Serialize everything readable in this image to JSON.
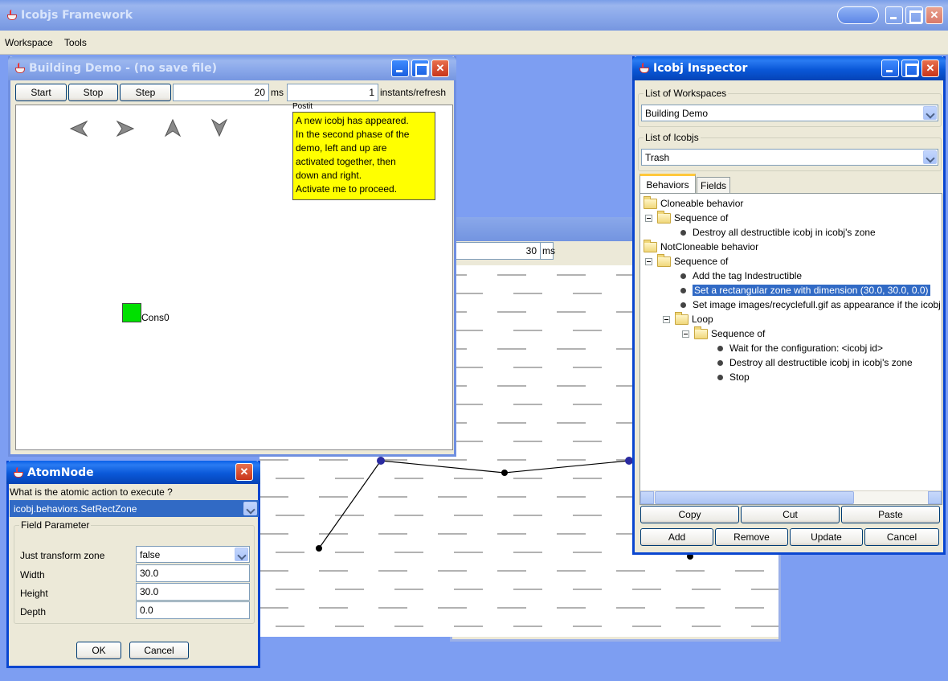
{
  "desktop": {
    "bg": "#7d9ef2"
  },
  "main_window": {
    "title": "Icobjs Framework",
    "menu": [
      "Workspace",
      "Tools"
    ]
  },
  "building_demo": {
    "title": "Building Demo - (no save file)",
    "start_label": "Start",
    "stop_label": "Stop",
    "step_label": "Step",
    "delay_value": "20",
    "delay_unit": "ms",
    "instants_value": "1",
    "instants_label": "instants/refresh",
    "postit_header": "Postit",
    "postit_text": [
      "A new icobj has appeared.",
      "In the second phase of the",
      "demo, left and up are",
      "activated together, then",
      "down and right.",
      "Activate me to proceed."
    ],
    "cons_label": "Cons0"
  },
  "background_window": {
    "delay_value": "30",
    "delay_unit": "ms"
  },
  "inspector": {
    "title": "Icobj Inspector",
    "workspaces_legend": "List of Workspaces",
    "workspace_selected": "Building Demo",
    "icobjs_legend": "List of Icobjs",
    "icobj_selected": "Trash",
    "tabs": [
      "Behaviors",
      "Fields"
    ],
    "tree": [
      "Cloneable behavior",
      "Sequence of",
      "Destroy all destructible icobj in icobj's zone",
      "NotCloneable behavior",
      "Sequence of",
      "Add the tag Indestructible",
      "Set a rectangular zone with dimension (30.0, 30.0, 0.0)",
      "Set image images/recyclefull.gif as appearance if the icobj has one",
      "Loop",
      "Sequence of",
      "Wait for the configuration: <icobj id>",
      "Destroy all destructible icobj in icobj's zone",
      "Stop"
    ],
    "buttons_row1": [
      "Copy",
      "Cut",
      "Paste"
    ],
    "buttons_row2": [
      "Add",
      "Remove",
      "Update",
      "Cancel"
    ]
  },
  "atomnode": {
    "title": "AtomNode",
    "question": "What is the atomic action to execute ?",
    "action_selected": "icobj.behaviors.SetRectZone",
    "params_legend": "Field Parameter",
    "params": [
      {
        "label": "Just transform zone",
        "value": "false"
      },
      {
        "label": "Width",
        "value": "30.0"
      },
      {
        "label": "Height",
        "value": "30.0"
      },
      {
        "label": "Depth",
        "value": "0.0"
      }
    ],
    "ok_label": "OK",
    "cancel_label": "Cancel"
  }
}
